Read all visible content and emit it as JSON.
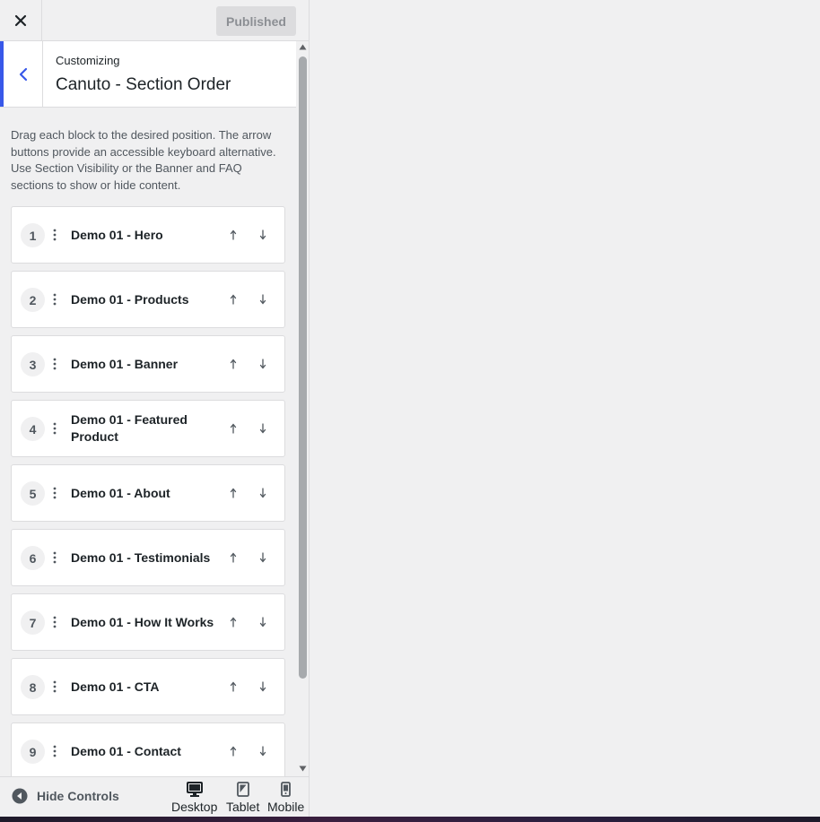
{
  "topbar": {
    "close_label": "×",
    "publish_label": "Published"
  },
  "header": {
    "breadcrumb": "Customizing",
    "title": "Canuto - Section Order"
  },
  "description": "Drag each block to the desired position. The arrow buttons provide an accessible keyboard alternative. Use Section Visibility or the Banner and FAQ sections to show or hide content.",
  "sections": [
    {
      "num": "1",
      "label": "Demo 01 - Hero"
    },
    {
      "num": "2",
      "label": "Demo 01 - Products"
    },
    {
      "num": "3",
      "label": "Demo 01 - Banner"
    },
    {
      "num": "4",
      "label": "Demo 01 - Featured Product"
    },
    {
      "num": "5",
      "label": "Demo 01 - About"
    },
    {
      "num": "6",
      "label": "Demo 01 - Testimonials"
    },
    {
      "num": "7",
      "label": "Demo 01 - How It Works"
    },
    {
      "num": "8",
      "label": "Demo 01 - CTA"
    },
    {
      "num": "9",
      "label": "Demo 01 - Contact"
    }
  ],
  "arrows": {
    "up": "↑",
    "down": "↓"
  },
  "footer": {
    "hide_controls": "Hide Controls",
    "devices": [
      {
        "label": "Desktop",
        "icon": "desktop-icon",
        "active": true
      },
      {
        "label": "Tablet",
        "icon": "tablet-icon",
        "active": false
      },
      {
        "label": "Mobile",
        "icon": "mobile-icon",
        "active": false
      }
    ]
  },
  "colors": {
    "accent": "#3858e9",
    "panel_bg": "#f0f0f1",
    "card_bg": "#ffffff",
    "border": "#dcdcde"
  }
}
